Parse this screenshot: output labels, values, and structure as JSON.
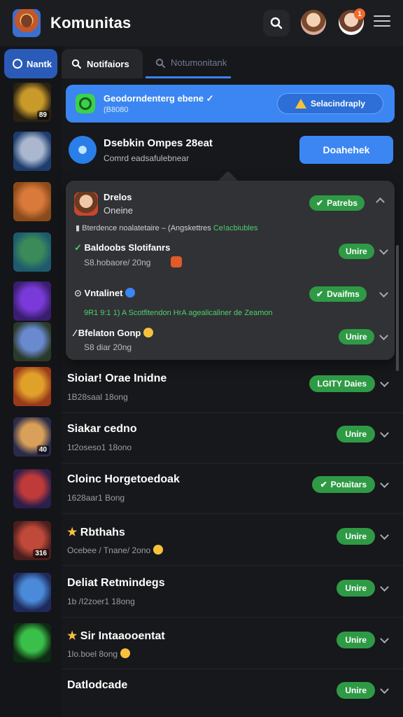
{
  "header": {
    "title": "Komunitas",
    "notif_count": "1"
  },
  "sidebar": {
    "tab_label": "Nantk",
    "thumbs": [
      {
        "badge": "89",
        "colors": [
          "#2a2113",
          "#c89a2a"
        ]
      },
      {
        "badge": "",
        "colors": [
          "#1e3d6e",
          "#aab7cf"
        ]
      },
      {
        "badge": "",
        "colors": [
          "#8a4a1a",
          "#d9793a"
        ]
      },
      {
        "badge": "",
        "colors": [
          "#1e5a6e",
          "#3a8a5a"
        ]
      },
      {
        "badge": "",
        "colors": [
          "#3a1e6e",
          "#7a3ad9"
        ]
      },
      {
        "badge": "",
        "colors": [
          "#2a3a2a",
          "#6a8acf"
        ]
      },
      {
        "badge": "",
        "colors": [
          "#9a3a1a",
          "#e0a02a"
        ]
      },
      {
        "badge": "40",
        "colors": [
          "#2a2a4a",
          "#d9a05a"
        ]
      },
      {
        "badge": "",
        "colors": [
          "#2a1e4a",
          "#c03a3a"
        ]
      },
      {
        "badge": "316",
        "colors": [
          "#4a1e1e",
          "#c04a3a"
        ]
      },
      {
        "badge": "",
        "colors": [
          "#1e2a5a",
          "#4a8ad9"
        ]
      },
      {
        "badge": "",
        "colors": [
          "#0e2a12",
          "#3ac04a"
        ]
      }
    ]
  },
  "tabs": {
    "active": "Notifaiors",
    "second": "Notumonitank"
  },
  "banner": {
    "title": "Geodorndenterg ebene",
    "subtitle": "(B8080",
    "button": "Selacindraply"
  },
  "community": {
    "title": "Dsebkin Ompes 28eat",
    "subtitle": "Comrd eadsafulebnear",
    "button": "Doahehek"
  },
  "panel": {
    "user_name": "Drelos",
    "user_status": "Oneine",
    "user_pill": "Patrebs",
    "activity_text": "Bterdence noalatetaire – (Angskettres",
    "activity_link": "Ce!acbiubles",
    "item1_title": "Baldoobs Slotifanrs",
    "item1_sub": "S8.hobaore/ 20ng",
    "item1_pill": "Unire",
    "item2_title": "Vntalinet",
    "item2_pill": "Dvaifms",
    "item2_line": "9R1  9:1 1) A  Scotfitendon  HrA agealicaliner de Zeamon",
    "item3_title": "Bfelaton Gonp",
    "item3_sub": "S8 diar 20ng",
    "item3_pill": "Unire"
  },
  "feed": [
    {
      "title": "Sioiar! Orae Inidne",
      "sub": "1B28saal 18ong",
      "pill": "LGITY Daies",
      "star": false,
      "emoji": false,
      "pill_icon": false
    },
    {
      "title": "Siakar cedno",
      "sub": "1t2oseso1 18ono",
      "pill": "Unire",
      "star": false,
      "emoji": false,
      "pill_icon": false
    },
    {
      "title": "Cloinc Horgetoedoak",
      "sub": "1628aar1 Bong",
      "pill": "Potaitars",
      "star": false,
      "emoji": false,
      "pill_icon": true
    },
    {
      "title": "Rbthahs",
      "sub": "Ocebee / Tnane/ 2ono",
      "pill": "Unire",
      "star": true,
      "emoji": true,
      "pill_icon": false
    },
    {
      "title": "Deliat Retmindegs",
      "sub": "1b /I2zoer1 18ong",
      "pill": "Unire",
      "star": false,
      "emoji": false,
      "pill_icon": false
    },
    {
      "title": "Sir Intaaooentat",
      "sub": "1lo.boel 8ong",
      "pill": "Unire",
      "star": true,
      "emoji": true,
      "pill_icon": false
    },
    {
      "title": "Datlodcade",
      "sub": "",
      "pill": "Unire",
      "star": false,
      "emoji": false,
      "pill_icon": false
    }
  ]
}
